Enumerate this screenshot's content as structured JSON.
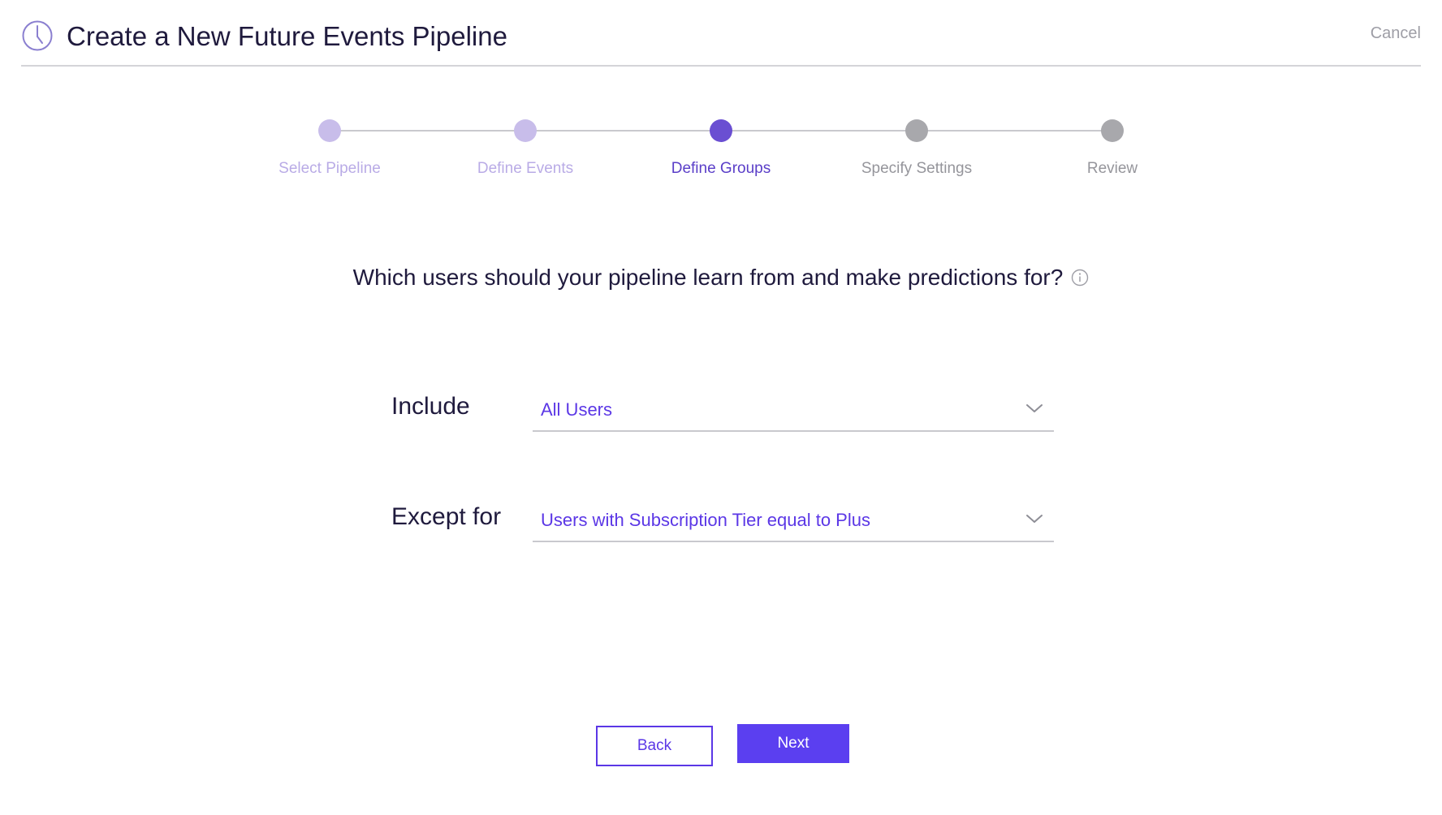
{
  "header": {
    "title": "Create a New Future Events Pipeline",
    "icon": "clock-icon",
    "cancel_label": "Cancel"
  },
  "stepper": {
    "steps": [
      {
        "label": "Select Pipeline",
        "state": "done"
      },
      {
        "label": "Define Events",
        "state": "done"
      },
      {
        "label": "Define Groups",
        "state": "active"
      },
      {
        "label": "Specify Settings",
        "state": "todo"
      },
      {
        "label": "Review",
        "state": "todo"
      }
    ]
  },
  "main": {
    "question": "Which users should your pipeline learn from and make predictions for?",
    "include": {
      "label": "Include",
      "value": "All Users"
    },
    "except": {
      "label": "Except for",
      "value": "Users with Subscription Tier equal to Plus"
    }
  },
  "footer": {
    "back_label": "Back",
    "next_label": "Next"
  },
  "colors": {
    "accent": "#5b3ff0",
    "step_done": "#c8bdea",
    "step_active": "#6a4fd2",
    "step_todo": "#a8a8ac",
    "title_text": "#1f1a3d"
  }
}
